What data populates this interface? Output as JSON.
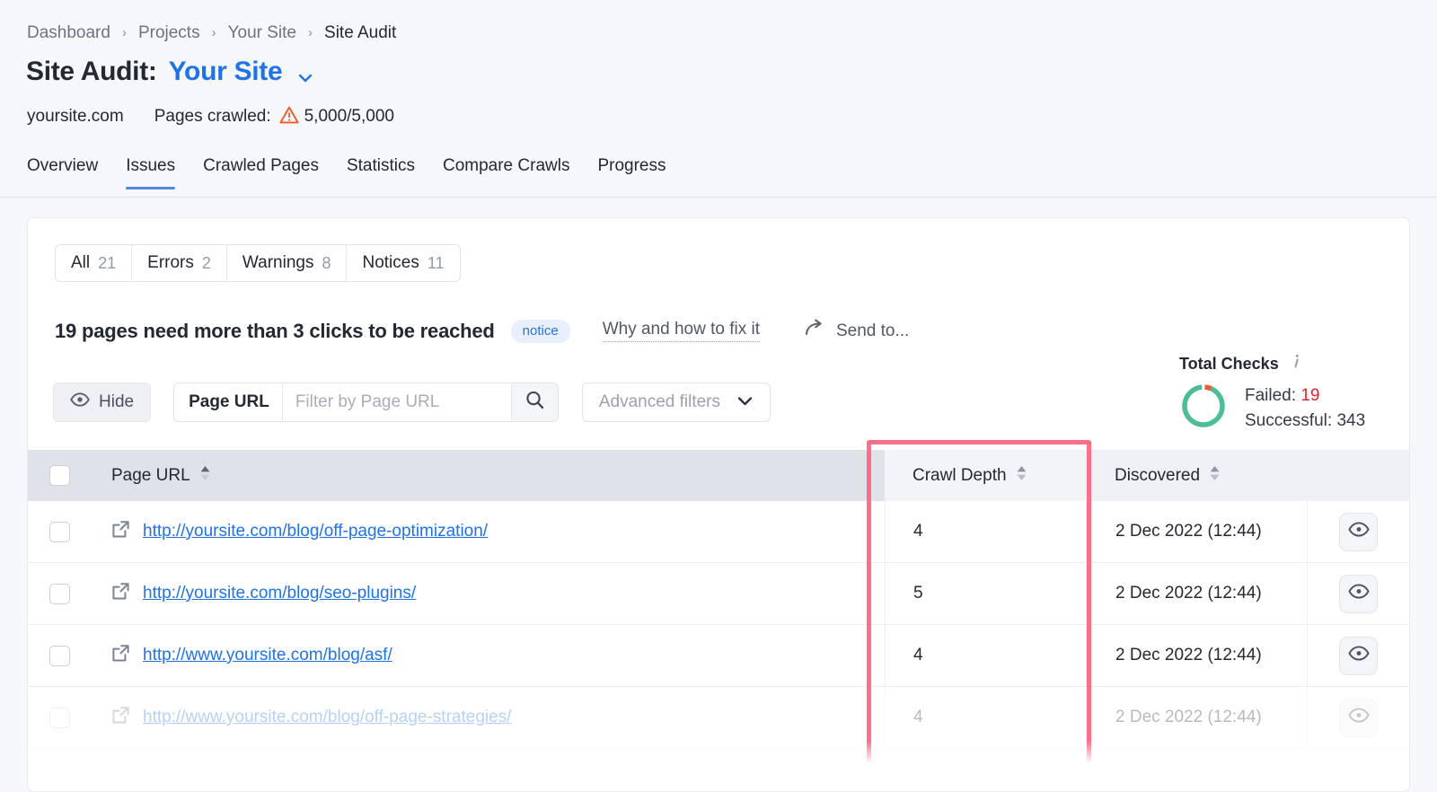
{
  "breadcrumb": {
    "items": [
      {
        "label": "Dashboard",
        "current": false
      },
      {
        "label": "Projects",
        "current": false
      },
      {
        "label": "Your Site",
        "current": false
      },
      {
        "label": "Site Audit",
        "current": true
      }
    ],
    "separator": "›"
  },
  "header": {
    "title_prefix": "Site Audit:",
    "site_name": "Your Site",
    "domain": "yoursite.com",
    "pages_crawled_label": "Pages crawled:",
    "pages_crawled_value": "5,000/5,000"
  },
  "main_tabs": [
    {
      "label": "Overview",
      "active": false
    },
    {
      "label": "Issues",
      "active": true
    },
    {
      "label": "Crawled Pages",
      "active": false
    },
    {
      "label": "Statistics",
      "active": false
    },
    {
      "label": "Compare Crawls",
      "active": false
    },
    {
      "label": "Progress",
      "active": false
    }
  ],
  "severity_filter": [
    {
      "label": "All",
      "count": "21"
    },
    {
      "label": "Errors",
      "count": "2"
    },
    {
      "label": "Warnings",
      "count": "8"
    },
    {
      "label": "Notices",
      "count": "11"
    }
  ],
  "issue": {
    "title": "19 pages need more than 3 clicks to be reached",
    "badge": "notice",
    "why_link": "Why and how to fix it",
    "send_to": "Send to..."
  },
  "toolbar": {
    "hide_label": "Hide",
    "url_filter_label": "Page URL",
    "url_filter_value": "",
    "url_filter_placeholder": "Filter by Page URL",
    "advanced_filters_label": "Advanced filters"
  },
  "total_checks": {
    "title": "Total Checks",
    "failed_label": "Failed:",
    "failed_value": "19",
    "successful_label": "Successful:",
    "successful_value": "343",
    "colors": {
      "successful": "#4dbd95",
      "failed": "#f2582a"
    }
  },
  "table": {
    "columns": [
      {
        "key": "url",
        "label": "Page URL",
        "sortable": true
      },
      {
        "key": "depth",
        "label": "Crawl Depth",
        "sortable": true
      },
      {
        "key": "discovered",
        "label": "Discovered",
        "sortable": true
      }
    ],
    "rows": [
      {
        "url": "http://yoursite.com/blog/off-page-optimization/",
        "depth": "4",
        "discovered": "2 Dec 2022 (12:44)",
        "faded": false
      },
      {
        "url": "http://yoursite.com/blog/seo-plugins/",
        "depth": "5",
        "discovered": "2 Dec 2022 (12:44)",
        "faded": false
      },
      {
        "url": "http://www.yoursite.com/blog/asf/",
        "depth": "4",
        "discovered": "2 Dec 2022 (12:44)",
        "faded": false
      },
      {
        "url": "http://www.yoursite.com/blog/off-page-strategies/",
        "depth": "4",
        "discovered": "2 Dec 2022 (12:44)",
        "faded": true
      }
    ]
  },
  "annotation": {
    "highlight_color": "#fc6f88",
    "target_column": "Crawl Depth"
  }
}
